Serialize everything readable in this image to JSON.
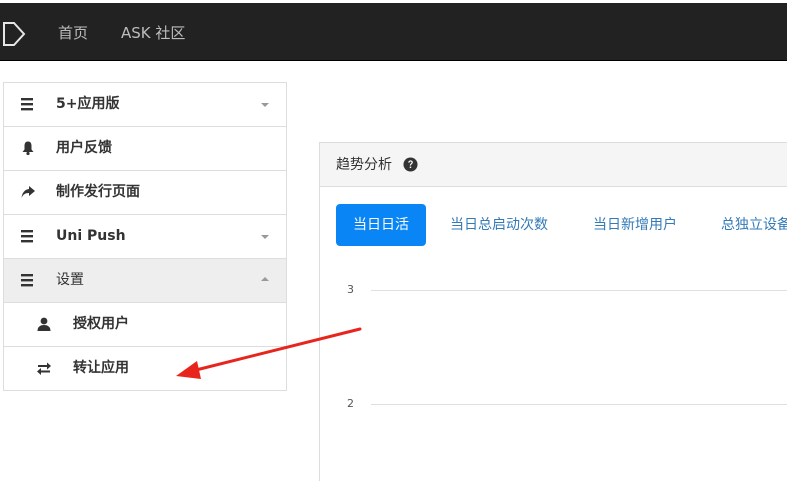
{
  "topbar": {
    "logo_icon": "dcloud-logo-icon",
    "nav": [
      "首页",
      "ASK 社区"
    ]
  },
  "sidebar": {
    "items": [
      {
        "label": "5+应用版",
        "icon": "menu-icon",
        "caret": "down"
      },
      {
        "label": "用户反馈",
        "icon": "bell-icon"
      },
      {
        "label": "制作发行页面",
        "icon": "share-arrow-icon"
      },
      {
        "label": "Uni Push",
        "icon": "menu-icon",
        "caret": "down"
      },
      {
        "label": "设置",
        "icon": "menu-icon",
        "caret": "up",
        "active": true
      },
      {
        "label": "授权用户",
        "icon": "user-icon",
        "sub": true
      },
      {
        "label": "转让应用",
        "icon": "transfer-icon",
        "sub": true
      }
    ]
  },
  "panel": {
    "title": "趋势分析",
    "help_icon": "question-circle-icon",
    "tabs": [
      "当日日活",
      "当日总启动次数",
      "当日新增用户",
      "总独立设备"
    ],
    "active_tab": 0
  },
  "chart_data": {
    "type": "line",
    "y_ticks": [
      "3",
      "2"
    ],
    "grid": true
  },
  "colors": {
    "topbar": "#222222",
    "active_tab": "#0a85f5",
    "link": "#337ab7",
    "annotation_arrow": "#e8251c"
  }
}
